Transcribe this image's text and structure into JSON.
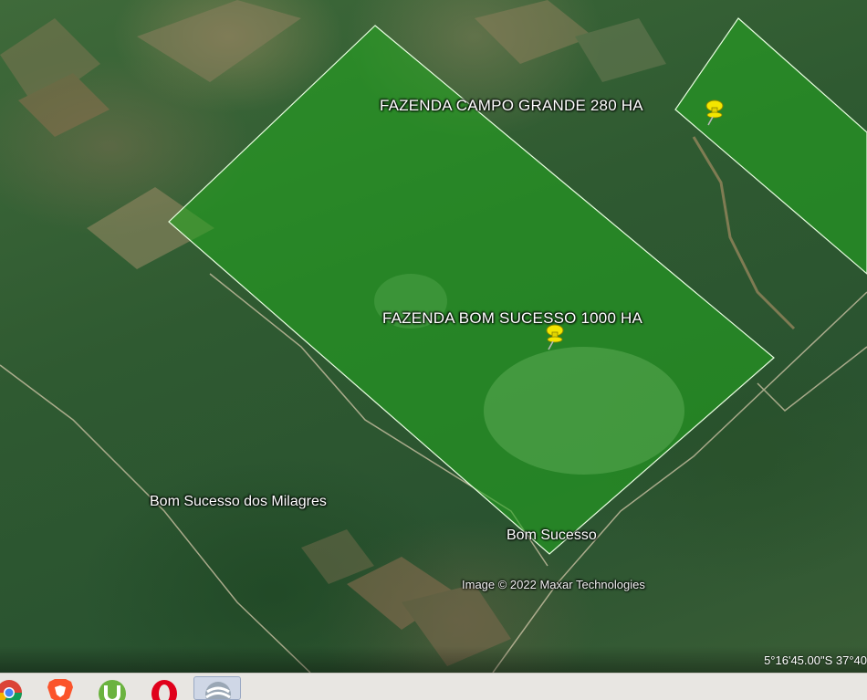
{
  "map": {
    "farms": [
      {
        "label": "FAZENDA CAMPO GRANDE 280 HA",
        "fill": "#22a61f",
        "pin_icon": "yellow-pushpin-icon"
      },
      {
        "label": "FAZENDA BOM SUCESSO 1000 HA",
        "fill": "#22a61f",
        "pin_icon": "yellow-pushpin-icon"
      }
    ],
    "places": [
      {
        "label": "Bom Sucesso dos Milagres"
      },
      {
        "label": "Bom Sucesso"
      }
    ],
    "credit": "Image © 2022 Maxar Technologies",
    "coordinates": "5°16'45.00\"S   37°40"
  },
  "taskbar": {
    "apps": [
      {
        "icon": "chrome-icon"
      },
      {
        "icon": "brave-icon"
      },
      {
        "icon": "utorrent-icon"
      },
      {
        "icon": "opera-icon"
      },
      {
        "icon": "google-earth-icon",
        "active": true
      }
    ]
  },
  "colors": {
    "polygon_fill": "#22a61f",
    "polygon_outline": "#e8ffe0",
    "pin": "#f3e600",
    "taskbar": "#e8e6e2"
  }
}
